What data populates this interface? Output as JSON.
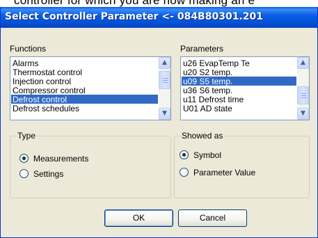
{
  "background_text": "controller for which you are now making an e",
  "dialog": {
    "title": "Select Controller Parameter <- 084B80301.201"
  },
  "functions": {
    "label": "Functions",
    "items": [
      {
        "label": "Alarms",
        "selected": false
      },
      {
        "label": "Thermostat control",
        "selected": false
      },
      {
        "label": "Injection control",
        "selected": false
      },
      {
        "label": "Compressor control",
        "selected": false
      },
      {
        "label": "Defrost control",
        "selected": true
      },
      {
        "label": "Defrost schedules",
        "selected": false
      }
    ]
  },
  "parameters": {
    "label": "Parameters",
    "items": [
      {
        "label": "u26 EvapTemp  Te",
        "selected": false
      },
      {
        "label": "u20 S2 temp.",
        "selected": false
      },
      {
        "label": "u09 S5 temp.",
        "selected": true
      },
      {
        "label": "u36 S6 temp.",
        "selected": false
      },
      {
        "label": "u11 Defrost time",
        "selected": false
      },
      {
        "label": "U01 AD state",
        "selected": false
      }
    ]
  },
  "type_group": {
    "title": "Type",
    "options": [
      {
        "label": "Measurements",
        "checked": true
      },
      {
        "label": "Settings",
        "checked": false
      }
    ]
  },
  "showed_as_group": {
    "title": "Showed as",
    "options": [
      {
        "label": "Symbol",
        "checked": true
      },
      {
        "label": "Parameter Value",
        "checked": false
      }
    ]
  },
  "buttons": {
    "ok": "OK",
    "cancel": "Cancel"
  },
  "colors": {
    "title_bar": "#0454d8",
    "selection": "#316ac5",
    "dialog_face": "#ece9d8"
  },
  "icons": {
    "scroll_up": "chevron-up-icon",
    "scroll_down": "chevron-down-icon",
    "radio_checked": "radio-checked-icon",
    "radio_unchecked": "radio-unchecked-icon"
  }
}
